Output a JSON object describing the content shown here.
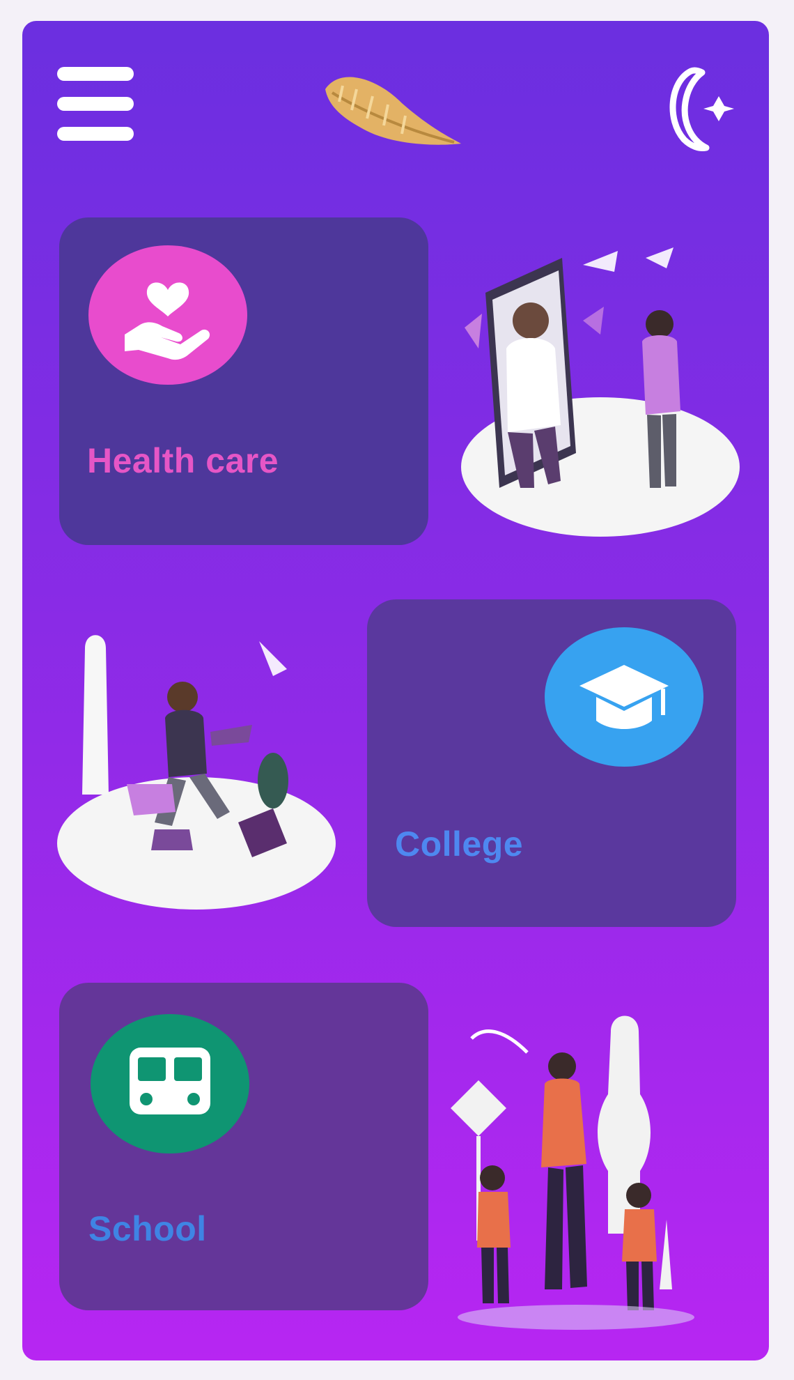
{
  "app": {
    "colors": {
      "gradient_top": "#6b2fe0",
      "gradient_bottom": "#b726f2",
      "logo": "#e3b265"
    },
    "header": {
      "menu_icon": "hamburger-menu-icon",
      "logo": "feather-logo",
      "theme_icon": "night-mode-moon-icon"
    }
  },
  "categories": [
    {
      "label": "Health care",
      "icon": "hand-heart-icon",
      "icon_color": "#e84ccd",
      "label_color": "#e656c6",
      "card_color": "#4e379b",
      "illustration": "doctor-telehealth-illustration"
    },
    {
      "label": "College",
      "icon": "graduation-cap-icon",
      "icon_color": "#37a2f0",
      "label_color": "#4e88f0",
      "card_color": "#5a389e",
      "illustration": "student-studying-illustration"
    },
    {
      "label": "School",
      "icon": "school-bus-icon",
      "icon_color": "#0f9572",
      "label_color": "#3f84e4",
      "card_color": "#643699",
      "illustration": "parent-children-walking-illustration"
    }
  ]
}
